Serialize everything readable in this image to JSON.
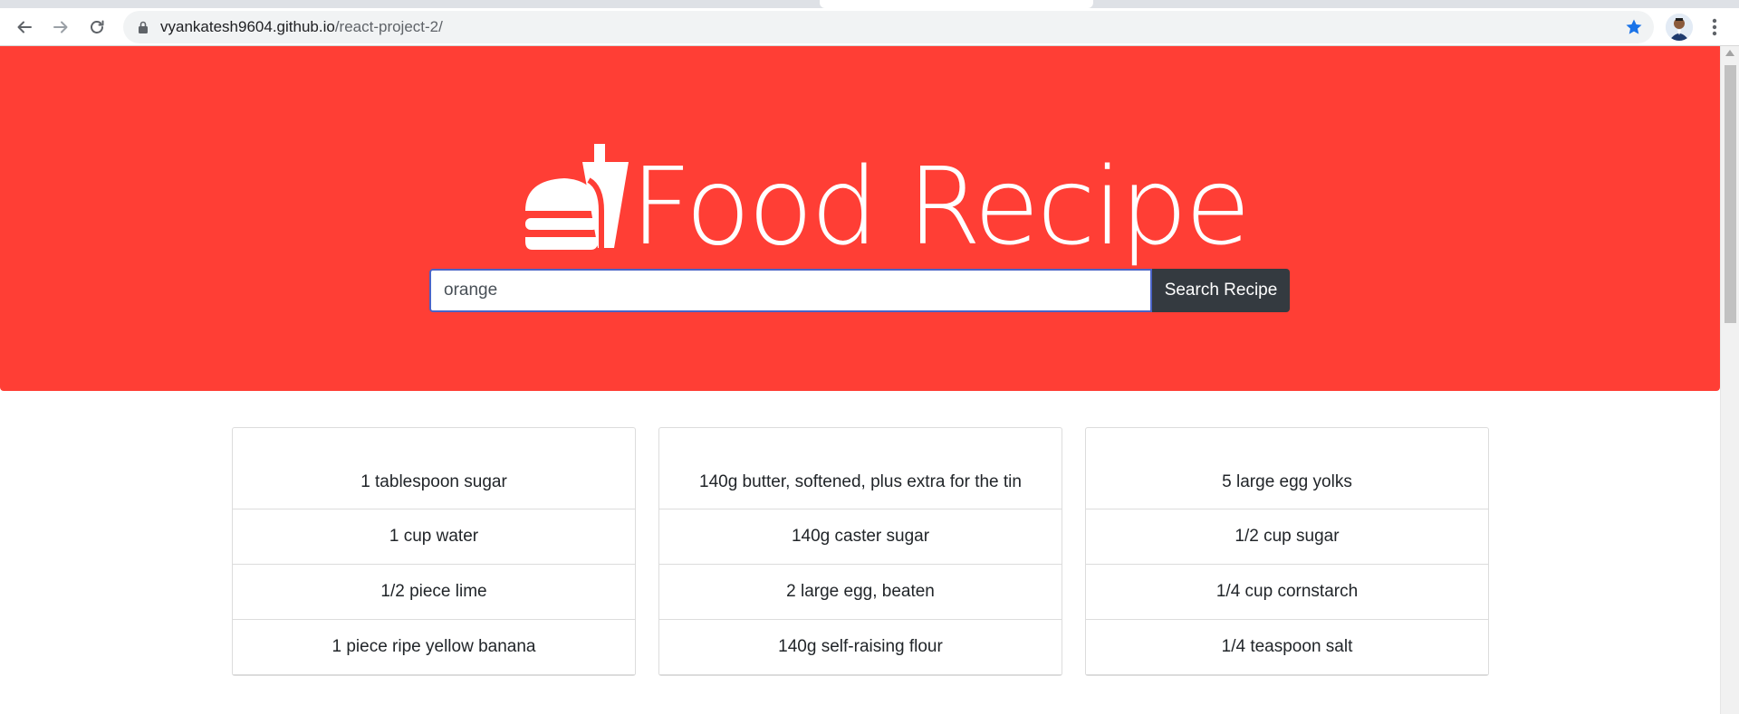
{
  "browser": {
    "url_host": "vyankatesh9604.github.io",
    "url_path": "/react-project-2/",
    "icons": [
      "back-icon",
      "forward-icon",
      "reload-icon",
      "lock-icon",
      "star-icon",
      "menu-icon"
    ]
  },
  "hero": {
    "title": "Food Recipe",
    "background": "#ff3e35",
    "icon": "burger-drink-icon"
  },
  "search": {
    "value": "orange",
    "button_label": "Search Recipe"
  },
  "cards": [
    {
      "ingredients": [
        "1 tablespoon sugar",
        "1 cup water",
        "1/2 piece lime",
        "1 piece ripe yellow banana"
      ]
    },
    {
      "ingredients": [
        "140g butter, softened, plus extra for the tin",
        "140g caster sugar",
        "2 large egg, beaten",
        "140g self-raising flour"
      ]
    },
    {
      "ingredients": [
        "5 large egg yolks",
        "1/2 cup sugar",
        "1/4 cup cornstarch",
        "1/4 teaspoon salt"
      ]
    }
  ]
}
